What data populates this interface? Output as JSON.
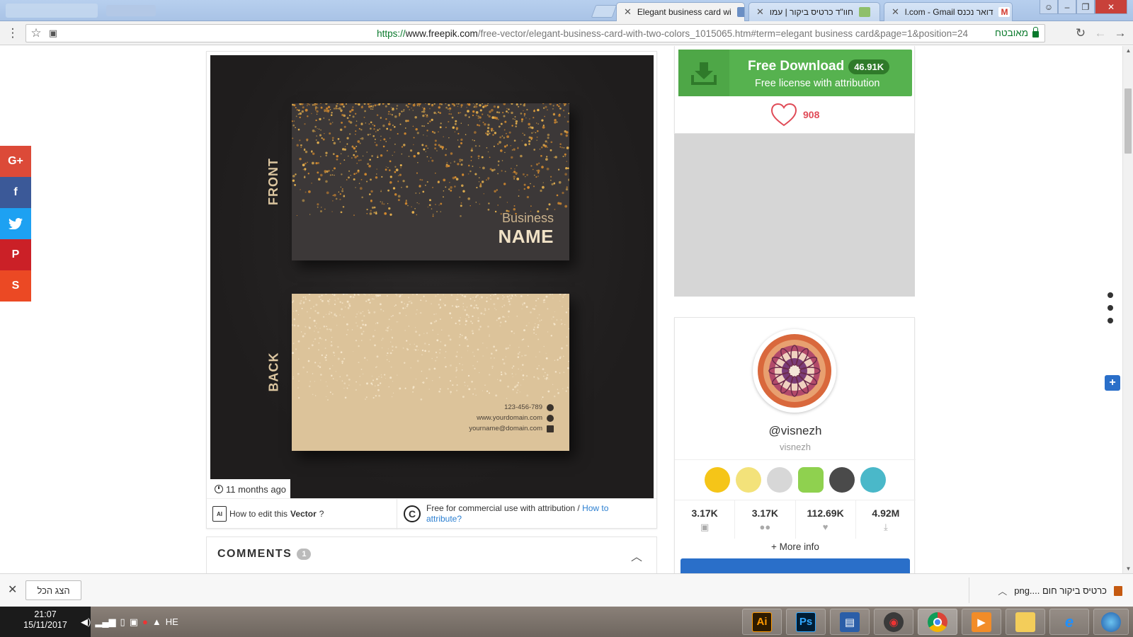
{
  "tabs": [
    {
      "label": "Elegant business card wi",
      "active": true
    },
    {
      "label": "חוו\"ד כרטיס ביקור | עמו",
      "active": false
    },
    {
      "label": "l.com - Gmail דואר נכנס",
      "active": false
    }
  ],
  "address": {
    "scheme": "https://",
    "host": "www.freepik.com",
    "path": "/free-vector/elegant-business-card-with-two-colors_1015065.htm#term=elegant business card&page=1&position=24",
    "secure_label": "מאובטח"
  },
  "social": [
    "G+",
    "f",
    "t",
    "P",
    "S"
  ],
  "preview": {
    "front_label": "FRONT",
    "back_label": "BACK",
    "business_line1": "Business",
    "business_line2": "NAME",
    "phone": "123-456-789",
    "website": "www.yourdomain.com",
    "email": "yourname@domain.com"
  },
  "meta": {
    "time_ago": "11 months ago",
    "edit_prefix": "How to edit this ",
    "edit_bold": "Vector",
    "edit_suffix": "?",
    "ai_icon": "AI",
    "cc_icon": "C",
    "license_text": "Free for commercial use with attribution / ",
    "license_link": "How to attribute?"
  },
  "comments": {
    "title": "COMMENTS",
    "count": "1"
  },
  "download": {
    "title": "Free Download",
    "count": "46.91K",
    "subtitle": "Free license with attribution"
  },
  "likes": "908",
  "author": {
    "handle": "@visnezh",
    "name": "visnezh",
    "stats": [
      {
        "value": "3.17K",
        "icon": "image-icon"
      },
      {
        "value": "3.17K",
        "icon": "users-icon"
      },
      {
        "value": "112.69K",
        "icon": "heart-icon"
      },
      {
        "value": "4.92M",
        "icon": "download-icon"
      }
    ],
    "more_info": "+ More info"
  },
  "shelf": {
    "show_all": "הצג הכל",
    "file": "png.... כרטיס ביקור חום"
  },
  "taskbar": {
    "time": "21:07",
    "date": "15/11/2017",
    "lang": "HE"
  }
}
